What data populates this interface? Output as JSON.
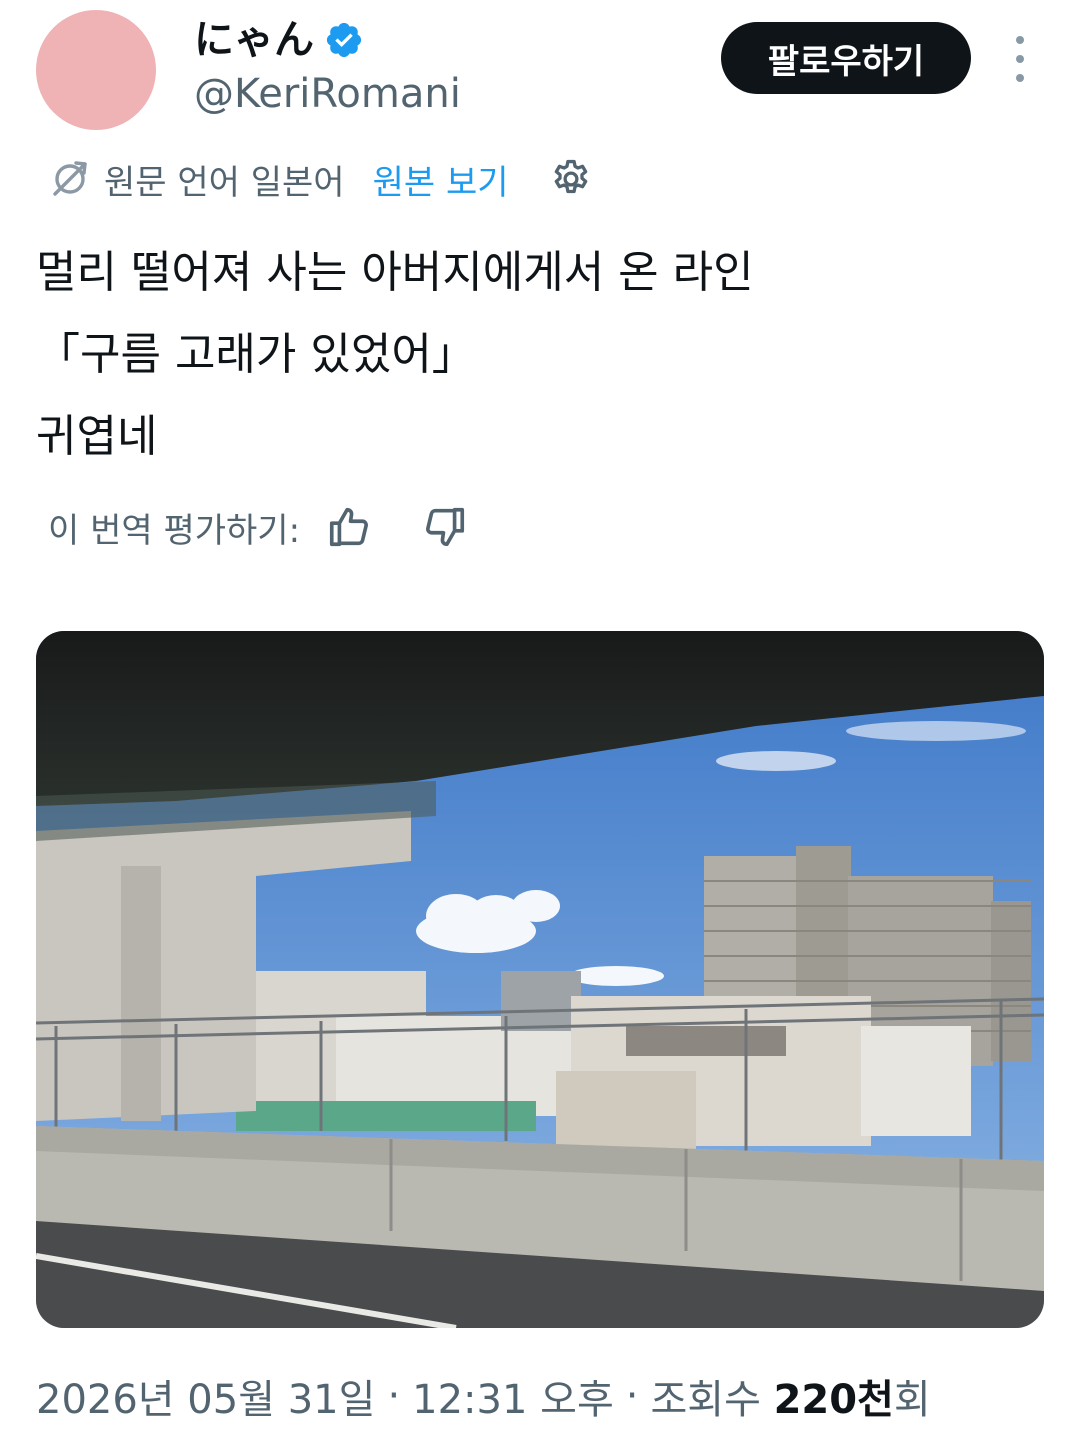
{
  "profile": {
    "display_name": "にゃん",
    "handle": "@KeriRomani",
    "avatar_color": "#efb2b5",
    "verified": true,
    "verified_icon": "verified-badge-icon",
    "verified_color": "#1d9bf0"
  },
  "header": {
    "follow_label": "팔로우하기",
    "more_icon": "more-vertical-icon"
  },
  "translation": {
    "icon": "translate-icon",
    "label": "원문 언어 일본어",
    "view_original_label": "원본 보기",
    "settings_icon": "gear-icon",
    "link_color": "#1d9bf0"
  },
  "tweet": {
    "text": "멀리 떨어져 사는 아버지에게서 온 라인\n「구름 고래가 있었어」\n귀엽네"
  },
  "rating": {
    "label": "이 번역 평가하기:",
    "thumbs_up_icon": "thumbs-up-icon",
    "thumbs_down_icon": "thumbs-down-icon"
  },
  "photo": {
    "subject": "photo-of-sky-through-car-window"
  },
  "meta": {
    "date": "2026년 05월 31일",
    "separator": "·",
    "time": "12:31 오후",
    "views_prefix": "조회수",
    "views_count": "220천",
    "views_suffix": "회"
  },
  "colors": {
    "text_primary": "#0f1419",
    "text_secondary": "#536471",
    "accent": "#1d9bf0",
    "follow_button_bg": "#0f1419"
  }
}
